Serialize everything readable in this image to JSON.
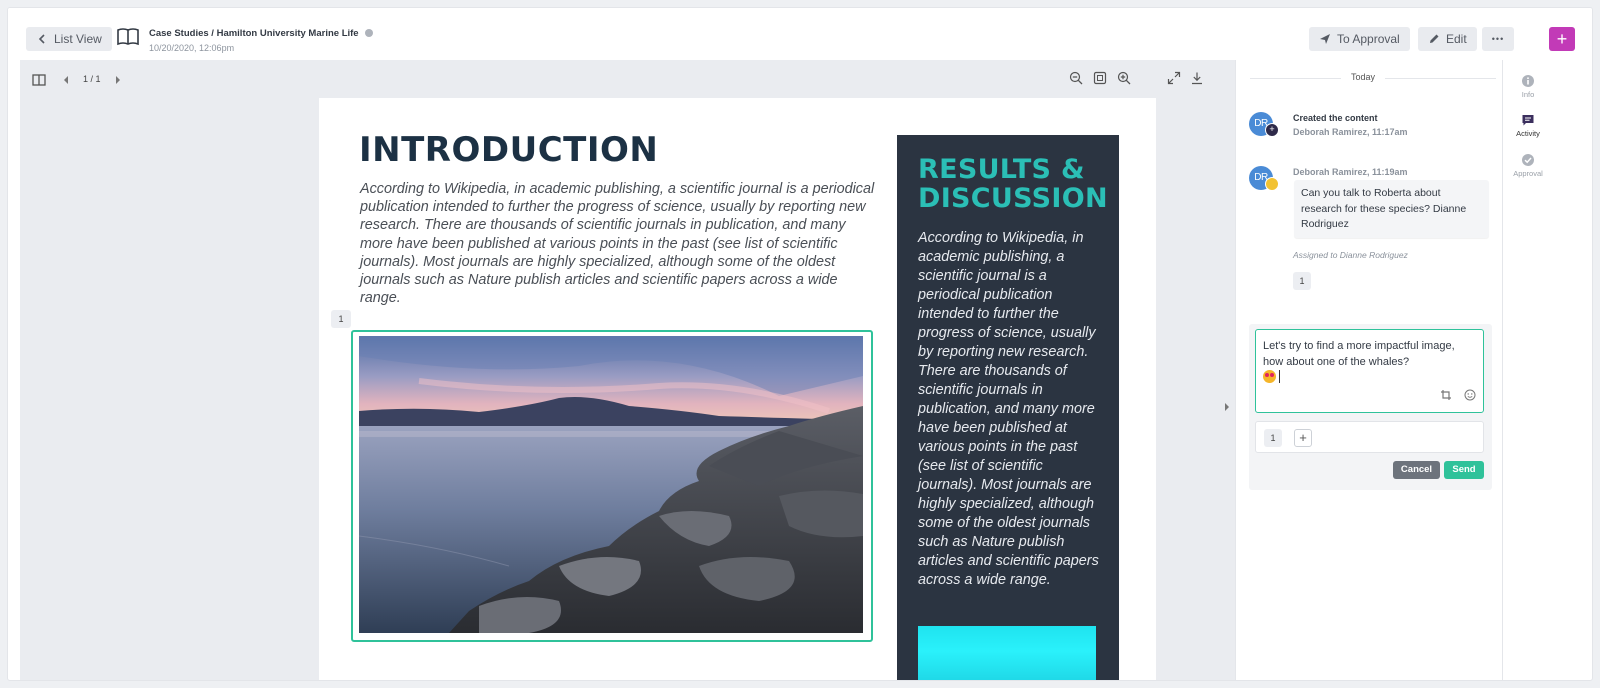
{
  "header": {
    "list_view_label": "List View",
    "breadcrumb": "Case Studies / Hamilton University Marine Life",
    "timestamp": "10/20/2020, 12:06pm",
    "to_approval_label": "To Approval",
    "edit_label": "Edit",
    "more_label": "•••",
    "add_label": "+"
  },
  "viewer": {
    "page_count": "1 / 1",
    "page": {
      "intro_title": "INTRODUCTION",
      "intro_text": "According to Wikipedia, in academic publishing, a scientific journal is a periodical publication intended to further the progress of science, usually by reporting new research. There are thousands of scientific journals in publication, and many more have been published at various points in the past (see list of scientific journals). Most journals are highly specialized, although some of the oldest journals such as Nature publish articles and scientific papers across a wide range.",
      "comment_count": "1",
      "results_title": "RESULTS & DISCUSSION",
      "results_text": "According to Wikipedia, in academic publishing, a scientific journal is a periodical publication intended to further the progress of science, usually by reporting new research. There are thousands of scientific journals in publication, and many more have been published at various points in the past (see list of scientific journals). Most journals are highly specialized, although some of the oldest journals such as Nature publish articles and scientific papers across a wide range."
    }
  },
  "activity": {
    "date_label": "Today",
    "entries": [
      {
        "avatar": "DR",
        "badge_icon": "plus-icon",
        "title": "Created the content",
        "meta": "Deborah Ramirez, 11:17am"
      },
      {
        "avatar": "DR",
        "badge_icon": "clipboard-icon",
        "meta": "Deborah Ramirez, 11:19am",
        "message": "Can you talk to Roberta about research for these species? Dianne Rodriguez",
        "assigned": "Assigned to Dianne Rodriguez",
        "count": "1"
      }
    ],
    "compose": {
      "text": "Let's try to find a more impactful image, how about one of the whales?",
      "count": "1",
      "cancel_label": "Cancel",
      "send_label": "Send"
    }
  },
  "rail": {
    "items": [
      {
        "label": "Info",
        "icon": "info-icon"
      },
      {
        "label": "Activity",
        "icon": "chat-icon"
      },
      {
        "label": "Approval",
        "icon": "check-circle-icon"
      }
    ]
  },
  "colors": {
    "accent": "#2fc29a",
    "brand": "#c23ab7",
    "title": "#1c3144",
    "results_title": "#2bbfb6",
    "panel_bg": "#2b3441"
  }
}
